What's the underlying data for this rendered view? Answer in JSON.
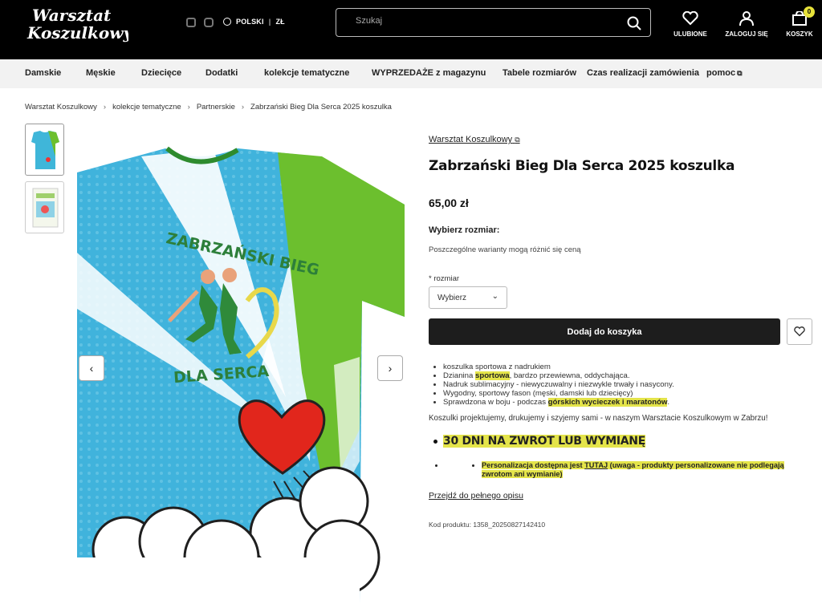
{
  "header": {
    "logo_text": [
      "Warsztat",
      "Koszulkowy"
    ],
    "language": "POLSKI",
    "currency": "ZŁ",
    "search_placeholder": "Szukaj",
    "favorites_label": "ULUBIONE",
    "login_label": "ZALOGUJ SIĘ",
    "cart_label": "KOSZYK",
    "cart_count": "0"
  },
  "nav": {
    "items": [
      {
        "label": "Damskie"
      },
      {
        "label": "Męskie"
      },
      {
        "label": "Dziecięce"
      },
      {
        "label": "Dodatki"
      },
      {
        "label": "kolekcje tematyczne"
      },
      {
        "label": "WYPRZEDAŻE z magazynu"
      },
      {
        "label": "Tabele rozmiarów"
      },
      {
        "label": "Czas realizacji zamówienia"
      },
      {
        "label": "pomoc"
      }
    ]
  },
  "breadcrumb": [
    "Warsztat Koszulkowy",
    "kolekcje tematyczne",
    "Partnerskie",
    "Zabrzański Bieg Dla Serca 2025 koszulka"
  ],
  "shirt_print": {
    "line1": "ZABRZAŃSKI BIEG",
    "line2": "DLA SERCA"
  },
  "product": {
    "brand": "Warsztat Koszulkowy",
    "title": "Zabrzański Bieg Dla Serca 2025 koszulka",
    "price": "65,00 zł",
    "choose_size": "Wybierz rozmiar:",
    "variants_note": "Poszczególne warianty mogą różnić się ceną",
    "size_label": "rozmiar",
    "size_required_mark": "*",
    "size_value": "Wybierz",
    "add_to_cart": "Dodaj do koszyka",
    "features": [
      {
        "pre": "koszulka sportowa z nadrukiem",
        "hl": "",
        "post": ""
      },
      {
        "pre": "Dzianina ",
        "hl": "sportowa",
        "post": ", bardzo przewiewna, oddychająca."
      },
      {
        "pre": "Nadruk sublimacyjny - niewyczuwalny i niezwykle trwały i nasycony.",
        "hl": "",
        "post": ""
      },
      {
        "pre": "Wygodny, sportowy fason (męski, damski lub dziecięcy)",
        "hl": "",
        "post": ""
      },
      {
        "pre": "Sprawdzona w boju - podczas ",
        "hl": "górskich wycieczek i maratonów",
        "post": "."
      }
    ],
    "about": "Koszulki projektujemy, drukujemy i szyjemy sami - w naszym Warsztacie Koszulkowym w Zabrzu!",
    "return_policy": "30 DNI NA ZWROT LUB WYMIANĘ",
    "personal_pre": "Personalizacja dostępna jest ",
    "personal_link": "TUTAJ",
    "personal_post": " (uwaga - produkty personalizowane nie podlegają zwrotom ani wymianie)",
    "full_desc_link": "Przejdź do pełnego opisu",
    "code_label": "Kod produktu:",
    "code_value": "1358_20250827142410"
  },
  "colors": {
    "header_bg": "#000000",
    "nav_bg": "#f2f2f2",
    "highlight": "#e4e44a",
    "button_dark": "#1d1d1d",
    "shirt_blue": "#3fb6d9",
    "shirt_green": "#6cbf2e"
  }
}
